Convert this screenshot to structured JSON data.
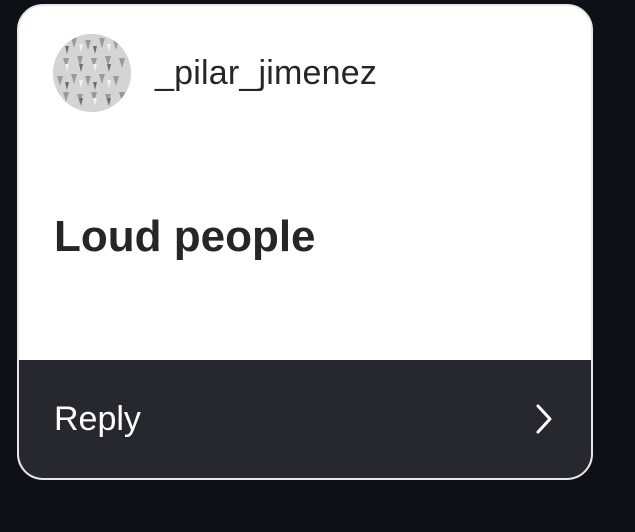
{
  "sticker": {
    "username": "_pilar_jimenez",
    "avatar_icon": "patterned-avatar",
    "question": "Loud people",
    "reply_label": "Reply",
    "reply_icon": "chevron-right-icon"
  },
  "colors": {
    "background": "#0d1117",
    "card": "#ffffff",
    "reply_bar": "#25282e",
    "text_dark": "#262626",
    "text_light": "#ffffff"
  }
}
